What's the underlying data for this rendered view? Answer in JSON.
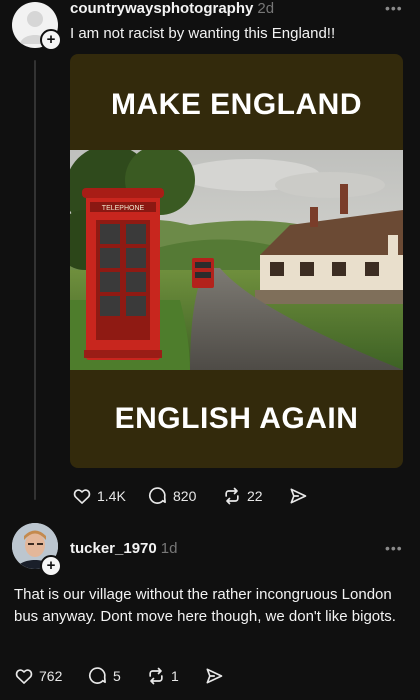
{
  "post": {
    "username": "countrywaysphotography",
    "time": "2d",
    "text": "I am not racist by wanting this England!!",
    "image": {
      "headline_top": "MAKE ENGLAND",
      "headline_bottom": "ENGLISH AGAIN",
      "booth_sign": "TELEPHONE"
    },
    "actions": {
      "likes": "1.4K",
      "comments": "820",
      "reposts": "22"
    }
  },
  "reply": {
    "username": "tucker_1970",
    "time": "1d",
    "text": "That is our village  without the rather incongruous London bus anyway. Dont move here though, we don't like bigots.",
    "actions": {
      "likes": "762",
      "comments": "5",
      "reposts": "1"
    }
  },
  "icons": [
    "plus-icon",
    "more-icon",
    "heart-icon",
    "comment-icon",
    "repost-icon",
    "share-icon"
  ]
}
